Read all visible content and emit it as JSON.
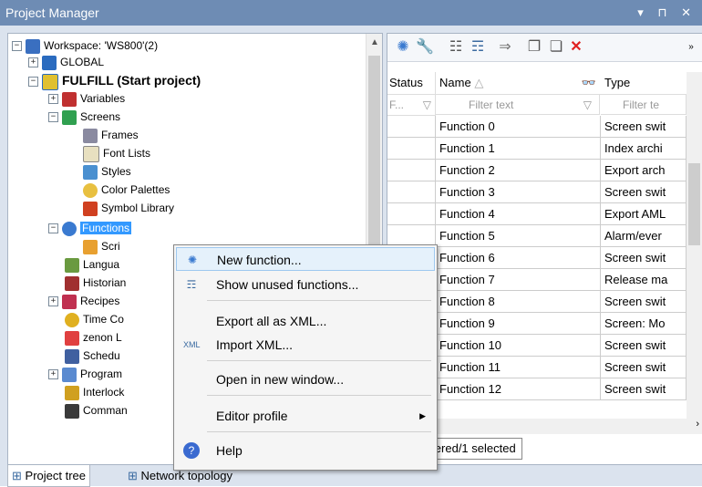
{
  "window": {
    "title": "Project Manager",
    "controls": "▾ ⊓ ✕"
  },
  "tree": {
    "workspace": "Workspace: 'WS800'(2)",
    "global": "GLOBAL",
    "project": "FULFILL (Start project)",
    "items": {
      "variables": "Variables",
      "screens": "Screens",
      "frames": "Frames",
      "font_lists": "Font Lists",
      "styles": "Styles",
      "color_palettes": "Color Palettes",
      "symbol_library": "Symbol Library",
      "functions": "Functions",
      "scripts": "Scri",
      "languages": "Langua",
      "historian": "Historian",
      "recipes": "Recipes",
      "time_control": "Time Co",
      "zenon": "zenon L",
      "scheduler": "Schedu",
      "programming": "Program",
      "interlocking": "Interlock",
      "commands": "Comman"
    }
  },
  "grid": {
    "columns": {
      "status": "Status",
      "name": "Name",
      "type": "Type"
    },
    "filter": {
      "status": "F...",
      "name": "Filter text",
      "type": "Filter te"
    },
    "rows": [
      {
        "name": "Function 0",
        "type": "Screen swit"
      },
      {
        "name": "Function 1",
        "type": "Index archi"
      },
      {
        "name": "Function 2",
        "type": "Export arch"
      },
      {
        "name": "Function 3",
        "type": "Screen swit"
      },
      {
        "name": "Function 4",
        "type": "Export AML"
      },
      {
        "name": "Function 5",
        "type": "Alarm/ever"
      },
      {
        "name": "Function 6",
        "type": "Screen swit"
      },
      {
        "name": "Function 7",
        "type": "Release ma"
      },
      {
        "name": "Function 8",
        "type": "Screen swit"
      },
      {
        "name": "Function 9",
        "type": "Screen: Mo"
      },
      {
        "name": "Function 10",
        "type": "Screen swit"
      },
      {
        "name": "Function 11",
        "type": "Screen swit"
      },
      {
        "name": "Function 12",
        "type": "Screen swit"
      }
    ],
    "status": "al/60 filtered/1 selected"
  },
  "context_menu": {
    "new_function": "New function...",
    "show_unused": "Show unused functions...",
    "export_all": "Export all as XML...",
    "import_xml": "Import XML...",
    "open_new_window": "Open in new window...",
    "editor_profile": "Editor profile",
    "help": "Help"
  },
  "tabs": {
    "project_tree": "Project tree",
    "network_topology": "Network topology"
  },
  "colors": {
    "title_bar": "#6e8cb4",
    "selection": "#3399ff",
    "panel_bg": "#dbe3ee"
  }
}
